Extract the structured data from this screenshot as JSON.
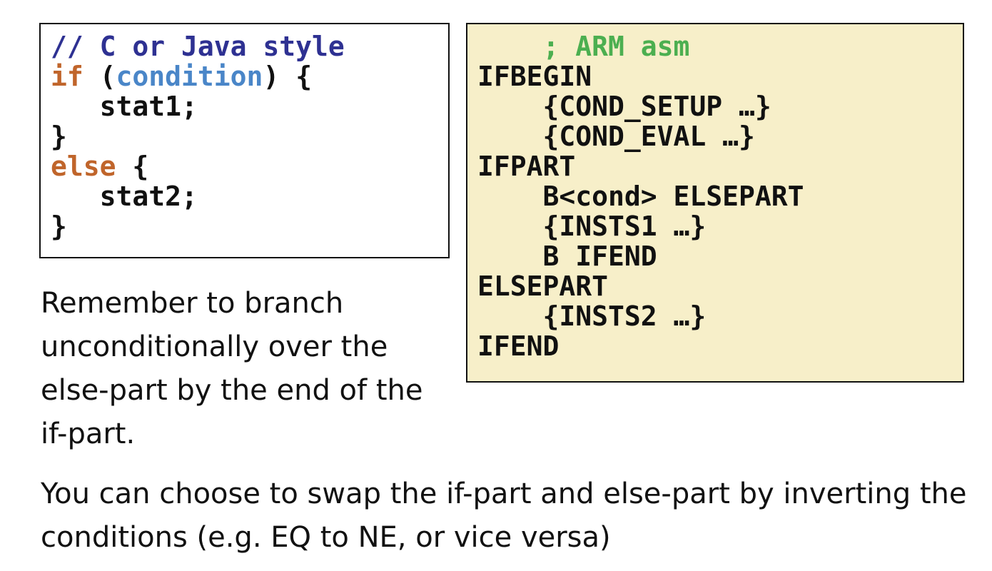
{
  "c_code": {
    "comment": "// C or Java style",
    "if_keyword": "if",
    "open_paren": " (",
    "condition": "condition",
    "close_paren_brace": ") {",
    "stat1": "   stat1;",
    "close_brace_1": "}",
    "else_keyword": "else",
    "else_brace": " {",
    "stat2": "   stat2;",
    "close_brace_2": "}"
  },
  "asm_code": {
    "comment": "    ; ARM asm",
    "lines": [
      "IFBEGIN",
      "    {COND_SETUP …}",
      "    {COND_EVAL …}",
      "IFPART",
      "    B<cond> ELSEPART",
      "    {INSTS1 …}",
      "    B IFEND",
      "ELSEPART",
      "    {INSTS2 …}",
      "IFEND"
    ]
  },
  "notes": {
    "remember": "Remember to branch unconditionally over the else-part by the end of the if-part.",
    "swap": "You can choose to swap the if-part and else-part by inverting the conditions (e.g. EQ to NE, or vice versa)"
  },
  "colors": {
    "c_comment": "#2e3192",
    "keyword": "#c0652b",
    "condition": "#4a86c8",
    "asm_comment": "#4caf50",
    "asm_background": "#f7efc9",
    "text": "#111111"
  }
}
